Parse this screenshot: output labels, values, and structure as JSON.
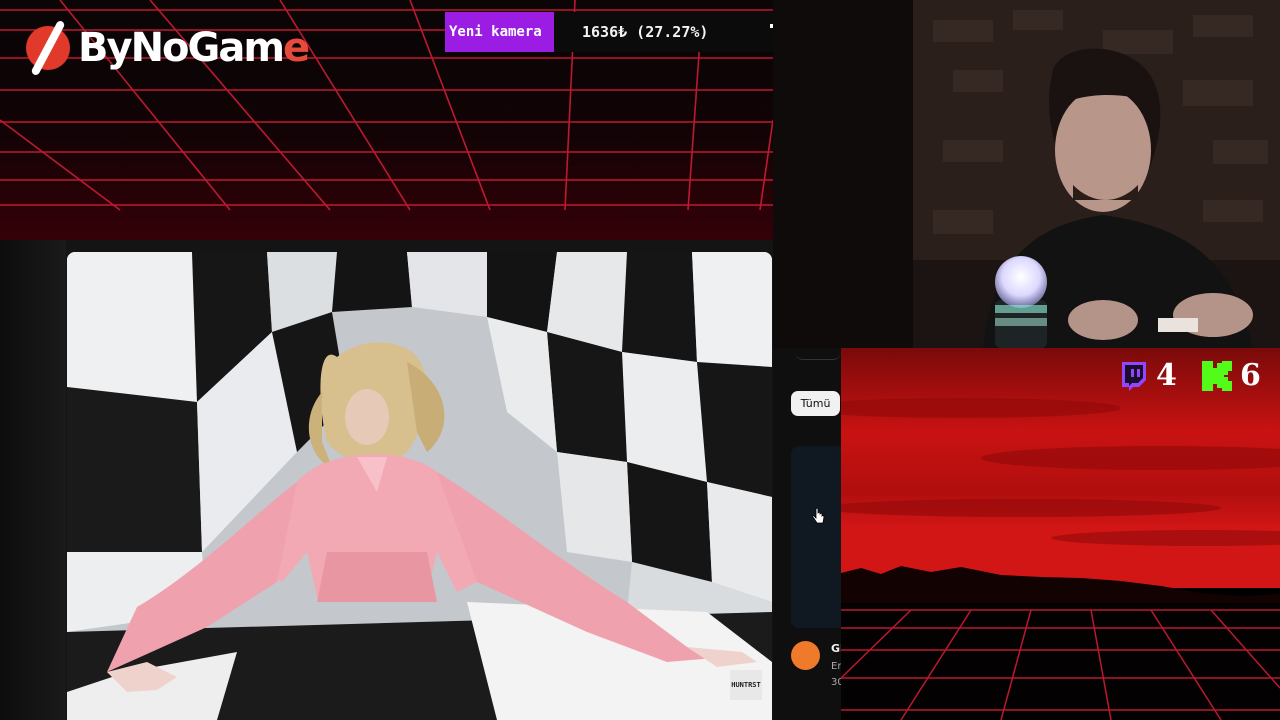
{
  "brand": {
    "logo_main": "ByNoGam",
    "logo_accent": "e"
  },
  "donation": {
    "tag": "Yeni kamera",
    "amount": "1636₺ (27.27%)"
  },
  "sidebar": {
    "chip_label": "Tümü",
    "item_title": "Gl",
    "item_sub1": "En",
    "item_sub2": "30"
  },
  "video": {
    "watermark": "HUNTRST"
  },
  "counters": {
    "twitch": {
      "icon": "twitch-icon",
      "value": "4",
      "color": "#9146ff"
    },
    "kick": {
      "icon": "kick-icon",
      "value": "6",
      "color": "#53fc18"
    }
  },
  "colors": {
    "grid_red": "#e0203a",
    "sky_red": "#c40c0c",
    "donation_purple": "#9b1de3"
  }
}
